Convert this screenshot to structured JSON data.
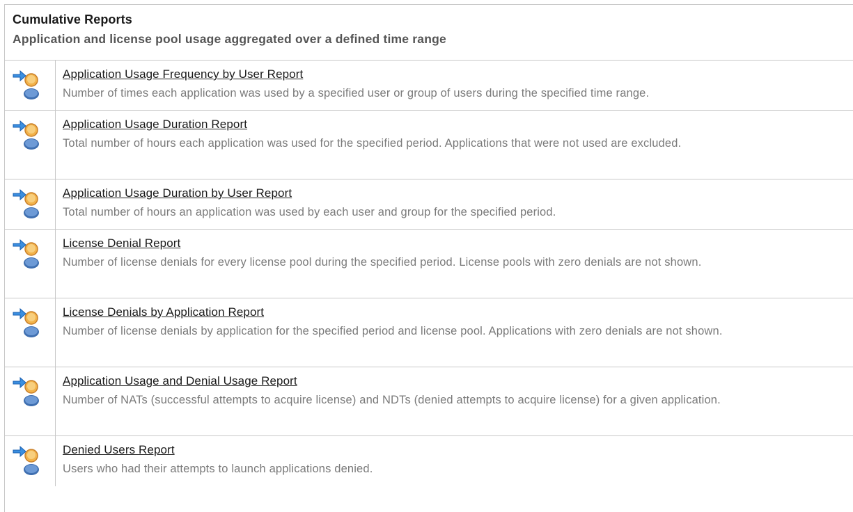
{
  "header": {
    "title": "Cumulative Reports",
    "subtitle": "Application and license pool usage aggregated over a defined time range"
  },
  "icon": "user-report-arrow-icon",
  "reports": [
    {
      "name": "Application Usage Frequency by User Report",
      "description": "Number of times each application was used by a specified user or group of users during the specified time range."
    },
    {
      "name": "Application Usage Duration Report",
      "description": "Total number of hours each application was used for the specified period. Applications that were not used are excluded."
    },
    {
      "name": "Application Usage Duration by User Report",
      "description": "Total number of hours an application was used by each user and group for the specified period."
    },
    {
      "name": "License Denial Report",
      "description": "Number of license denials for every license pool during the specified period. License pools with zero denials are not shown."
    },
    {
      "name": "License Denials by Application Report",
      "description": "Number of license denials by application for the specified period and license pool. Applications with zero denials are not shown."
    },
    {
      "name": "Application Usage and Denial Usage Report",
      "description": "Number of NATs (successful attempts to acquire license) and NDTs (denied attempts to acquire license) for a given application."
    },
    {
      "name": "Denied Users Report",
      "description": "Users who had their attempts to launch applications denied."
    }
  ]
}
